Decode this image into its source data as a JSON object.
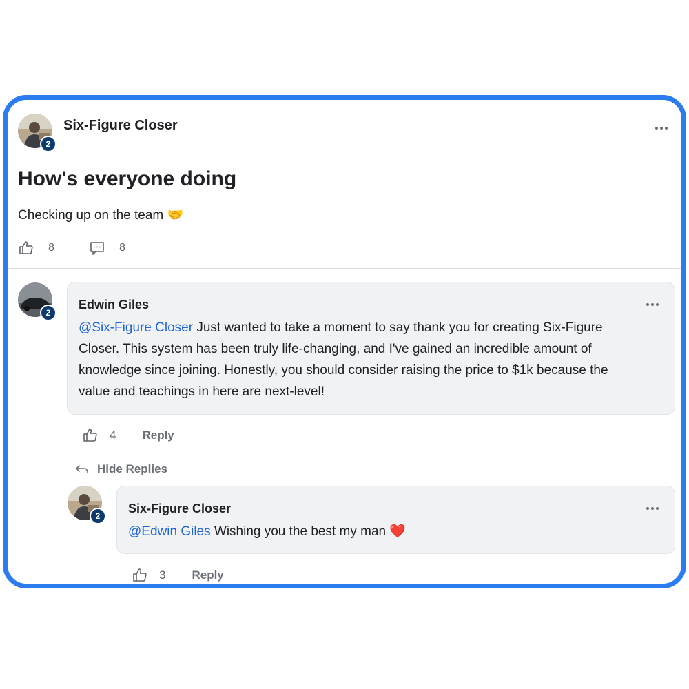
{
  "post": {
    "author": "Six-Figure Closer",
    "author_level": "2",
    "title": "How's everyone doing",
    "body": "Checking up on the team 🤝",
    "likes": "8",
    "comments": "8"
  },
  "comments": [
    {
      "author": "Edwin Giles",
      "author_level": "2",
      "mention": "@Six-Figure Closer",
      "text_line1": " Just wanted to take a moment to say thank you for creating Six-Figure",
      "text_line2": "Closer. This system has been truly life-changing, and I've gained an incredible amount of",
      "text_line3": "knowledge since joining. Honestly, you should consider raising the price to $1k because the",
      "text_line4": "value and teachings in here are next-level!",
      "likes": "4",
      "reply_label": "Reply"
    }
  ],
  "hide_replies_label": "Hide Replies",
  "reply": {
    "author": "Six-Figure Closer",
    "author_level": "2",
    "mention": "@Edwin Giles",
    "text": " Wishing you the best my man ❤️",
    "likes": "3",
    "reply_label": "Reply"
  },
  "colors": {
    "frame_border": "#2c7cf0",
    "mention": "#2166d6",
    "badge": "#0d3b6e",
    "bubble_bg": "#f1f2f4"
  },
  "icons": [
    "thumbs-up-icon",
    "comment-icon",
    "more-options-icon",
    "hide-replies-arrow-icon"
  ]
}
